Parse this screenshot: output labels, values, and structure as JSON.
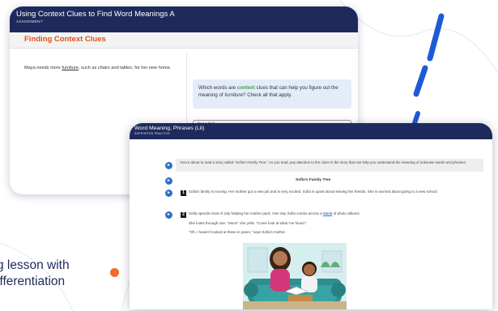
{
  "back_window": {
    "title": "Using Context Clues to Find Word Meanings A",
    "subtitle": "ASSIGNMENT",
    "section_title": "Finding Context Clues",
    "passage_before": "Maya needs more ",
    "passage_word": "furniture",
    "passage_after": ", such as chairs and tables, for her new home.",
    "question_before": "Which words are ",
    "question_highlight": "context",
    "question_middle": " clues that can help you figure out the meaning of ",
    "question_word": "furniture",
    "question_after": "? Check all that apply.",
    "answer_option": "\"needs\""
  },
  "front_window": {
    "title": "Word Meaning, Phrases (Lit)",
    "subtitle": "SUPPORTED PRACTICE",
    "intro": "You're about to read a story called \"Sofia's Family Tree.\" As you read, pay attention to the clues in the story that can help you understand the meaning of unknown words and phrases.",
    "story_title": "Sofia's Family Tree",
    "para1_num": "1",
    "para1": "Sofia's family is moving. Her mother got a new job and is very excited. Sofia is upset about leaving her friends. She is worried about going to a new school.",
    "para2_num": "2",
    "para2_before": "Sofia spends most of July helping her mother pack. One day Sofia comes across a ",
    "para2_word": "stack",
    "para2_after": " of photo albums.",
    "line3": "She looks through one. \"Mom!\" she yells. \"Come look at what I've found.\"",
    "line4": "\"Oh, I haven't looked at these in years,\" says Sofia's mother."
  },
  "tagline": {
    "line1": "g lesson with",
    "line2": "ifferentiation"
  },
  "colors": {
    "navy": "#1e2a5c",
    "accent_orange": "#d9531e",
    "blue": "#1e5ad6",
    "speaker_blue": "#2c73c9",
    "context_green": "#3aa646",
    "dot_orange": "#f26a2e"
  }
}
